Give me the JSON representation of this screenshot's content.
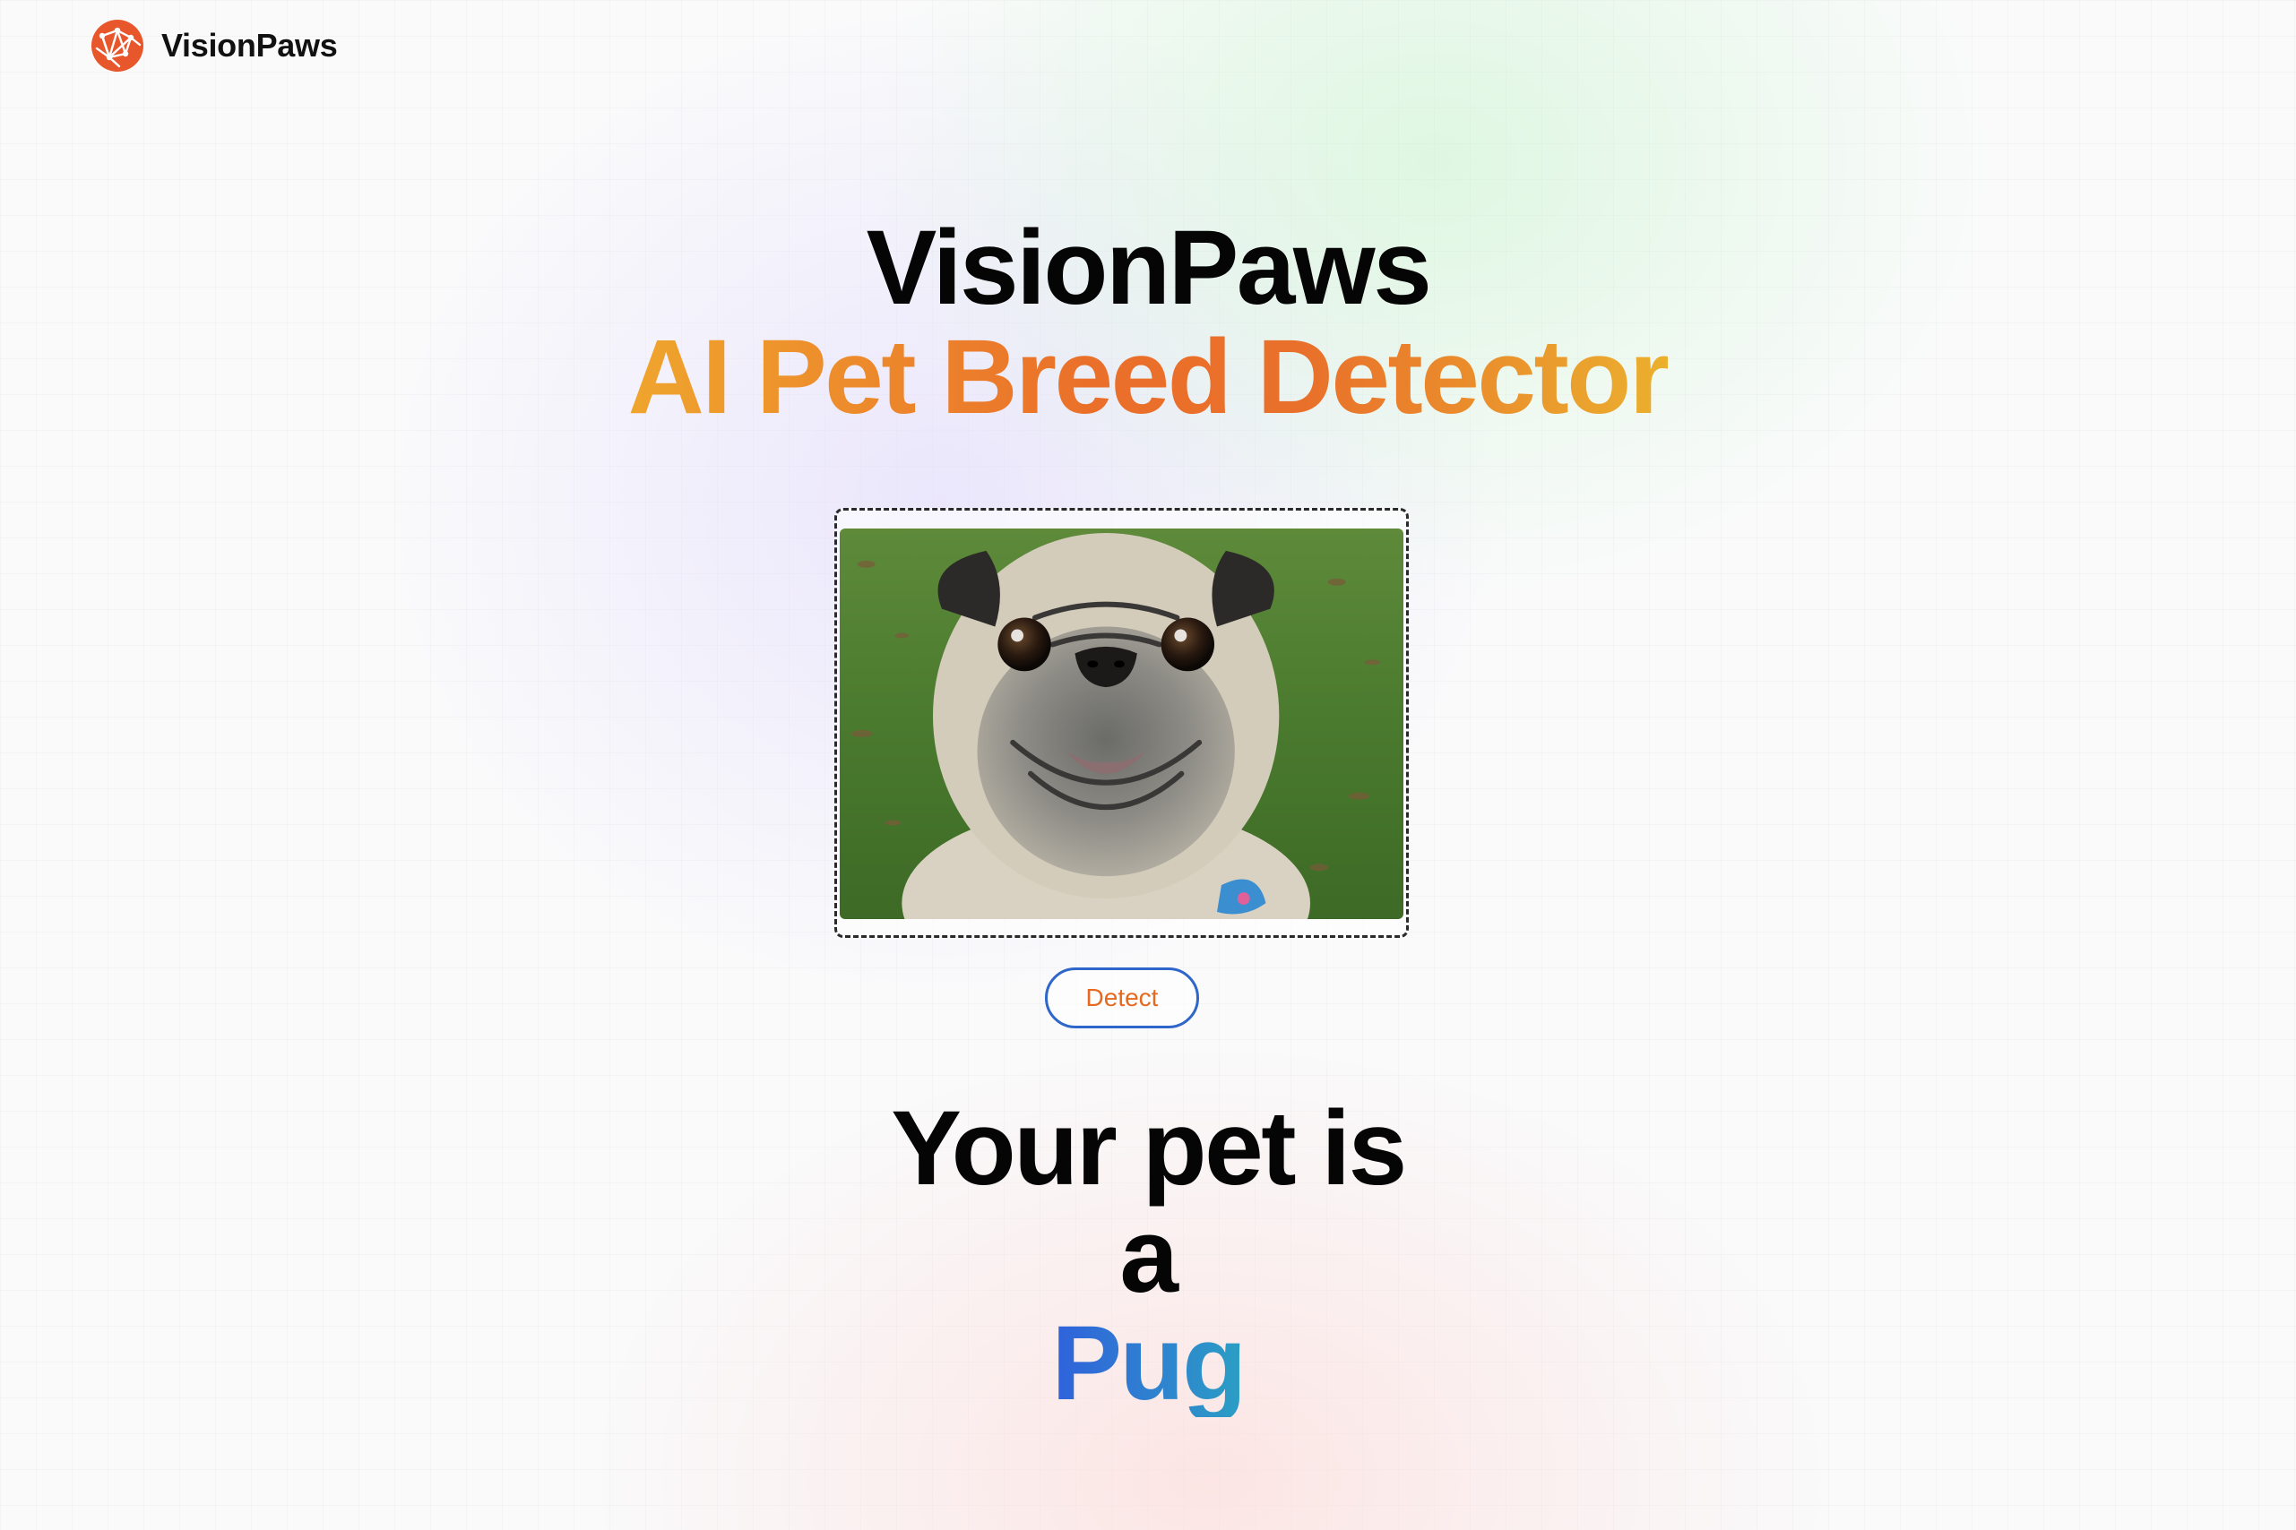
{
  "app": {
    "name": "VisionPaws",
    "logo_icon": "globe-network-icon",
    "brand_color": "#e8562c"
  },
  "hero": {
    "title": "VisionPaws",
    "subtitle": "AI Pet Breed Detector",
    "subtitle_gradient": [
      "#efa52d",
      "#ea6f2a",
      "#ebb02e"
    ]
  },
  "upload": {
    "image_alt": "uploaded pet photo (pug)"
  },
  "actions": {
    "detect_label": "Detect",
    "detect_border_color": "#2f66c9",
    "detect_text_color": "#e56a1f"
  },
  "result": {
    "line1": "Your pet is",
    "line2": "a",
    "breed": "Pug",
    "breed_gradient": [
      "#2f61db",
      "#2b9fc4"
    ]
  }
}
